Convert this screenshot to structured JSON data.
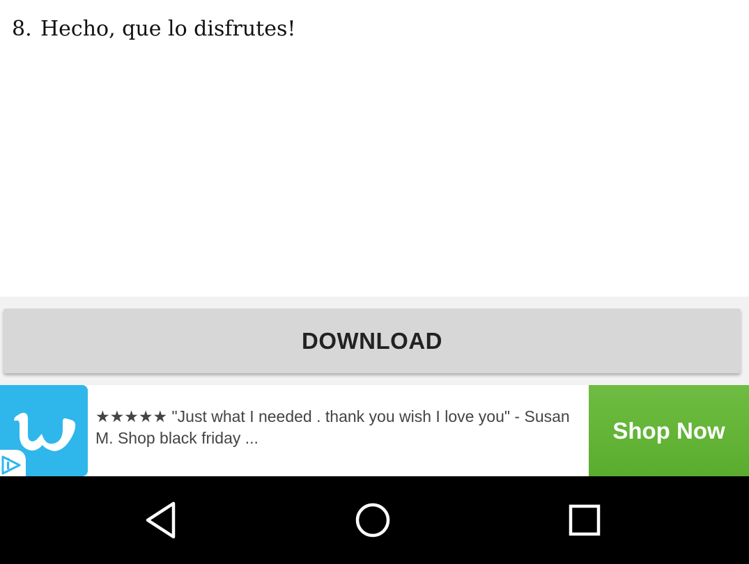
{
  "step": {
    "number": "8.",
    "text": "Hecho, que lo disfrutes!"
  },
  "download": {
    "label": "DOWNLOAD"
  },
  "ad": {
    "brand_icon": "wish-logo-icon",
    "text": "★★★★★ \"Just what I needed . thank you wish I love you\" - Susan M. Shop black friday ...",
    "cta": "Shop Now",
    "adchoices_icon": "adchoices-icon",
    "colors": {
      "logo_bg": "#2fb7ec",
      "cta_bg": "#62b536"
    }
  },
  "nav": {
    "back_icon": "back-triangle-icon",
    "home_icon": "home-circle-icon",
    "recents_icon": "recents-square-icon"
  }
}
